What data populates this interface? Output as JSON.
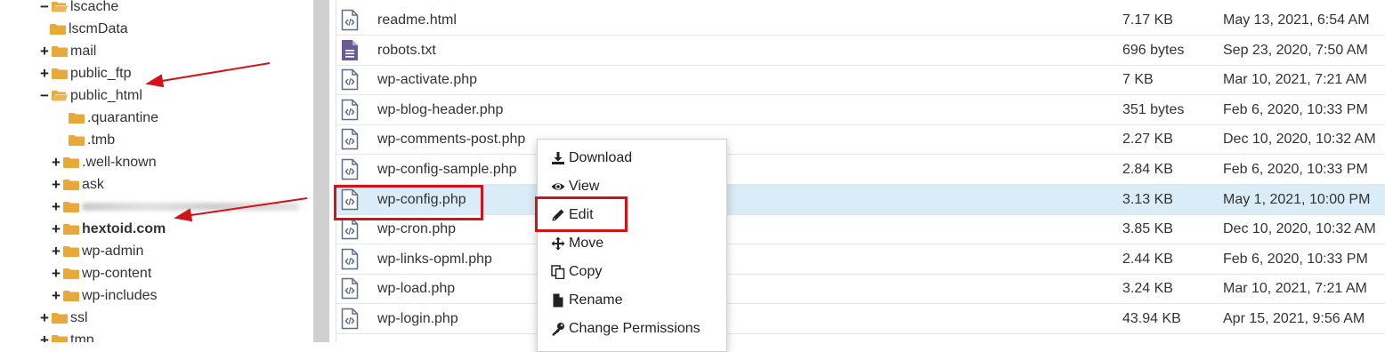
{
  "tree": [
    {
      "label": "lscache",
      "toggle": "−",
      "indent": 0,
      "open": true,
      "bold": false
    },
    {
      "label": "lscmData",
      "toggle": "",
      "indent": 1,
      "open": false,
      "bold": false
    },
    {
      "label": "mail",
      "toggle": "+",
      "indent": 0,
      "open": false,
      "bold": false
    },
    {
      "label": "public_ftp",
      "toggle": "+",
      "indent": 0,
      "open": false,
      "bold": false
    },
    {
      "label": "public_html",
      "toggle": "−",
      "indent": 0,
      "open": true,
      "bold": false
    },
    {
      "label": ".quarantine",
      "toggle": "",
      "indent": 2,
      "open": false,
      "bold": false
    },
    {
      "label": ".tmb",
      "toggle": "",
      "indent": 2,
      "open": false,
      "bold": false
    },
    {
      "label": ".well-known",
      "toggle": "+",
      "indent": 1,
      "open": false,
      "bold": false
    },
    {
      "label": "ask",
      "toggle": "+",
      "indent": 1,
      "open": false,
      "bold": false
    },
    {
      "label": "",
      "toggle": "+",
      "indent": 1,
      "open": false,
      "bold": false,
      "blurred": true
    },
    {
      "label": "hextoid.com",
      "toggle": "+",
      "indent": 1,
      "open": false,
      "bold": true
    },
    {
      "label": "wp-admin",
      "toggle": "+",
      "indent": 1,
      "open": false,
      "bold": false
    },
    {
      "label": "wp-content",
      "toggle": "+",
      "indent": 1,
      "open": false,
      "bold": false
    },
    {
      "label": "wp-includes",
      "toggle": "+",
      "indent": 1,
      "open": false,
      "bold": false
    },
    {
      "label": "ssl",
      "toggle": "+",
      "indent": 0,
      "open": false,
      "bold": false
    },
    {
      "label": "tmp",
      "toggle": "+",
      "indent": 0,
      "open": false,
      "bold": false
    }
  ],
  "files": [
    {
      "name": "readme.html",
      "size": "7.17 KB",
      "date": "May 13, 2021, 6:54 AM",
      "kind": "code",
      "selected": false
    },
    {
      "name": "robots.txt",
      "size": "696 bytes",
      "date": "Sep 23, 2020, 7:50 AM",
      "kind": "text",
      "selected": false
    },
    {
      "name": "wp-activate.php",
      "size": "7 KB",
      "date": "Mar 10, 2021, 7:21 AM",
      "kind": "code",
      "selected": false
    },
    {
      "name": "wp-blog-header.php",
      "size": "351 bytes",
      "date": "Feb 6, 2020, 10:33 PM",
      "kind": "code",
      "selected": false
    },
    {
      "name": "wp-comments-post.php",
      "size": "2.27 KB",
      "date": "Dec 10, 2020, 10:32 AM",
      "kind": "code",
      "selected": false
    },
    {
      "name": "wp-config-sample.php",
      "size": "2.84 KB",
      "date": "Feb 6, 2020, 10:33 PM",
      "kind": "code",
      "selected": false
    },
    {
      "name": "wp-config.php",
      "size": "3.13 KB",
      "date": "May 1, 2021, 10:00 PM",
      "kind": "code",
      "selected": true
    },
    {
      "name": "wp-cron.php",
      "size": "3.85 KB",
      "date": "Dec 10, 2020, 10:32 AM",
      "kind": "code",
      "selected": false
    },
    {
      "name": "wp-links-opml.php",
      "size": "2.44 KB",
      "date": "Feb 6, 2020, 10:33 PM",
      "kind": "code",
      "selected": false
    },
    {
      "name": "wp-load.php",
      "size": "3.24 KB",
      "date": "Mar 10, 2021, 7:21 AM",
      "kind": "code",
      "selected": false
    },
    {
      "name": "wp-login.php",
      "size": "43.94 KB",
      "date": "Apr 15, 2021, 9:56 AM",
      "kind": "code",
      "selected": false
    }
  ],
  "context_menu": [
    {
      "label": "Download",
      "icon": "download-icon"
    },
    {
      "label": "View",
      "icon": "eye-icon"
    },
    {
      "label": "Edit",
      "icon": "pencil-icon"
    },
    {
      "label": "Move",
      "icon": "move-arrows-icon"
    },
    {
      "label": "Copy",
      "icon": "copy-icon"
    },
    {
      "label": "Rename",
      "icon": "file-icon"
    },
    {
      "label": "Change Permissions",
      "icon": "key-icon"
    }
  ],
  "colors": {
    "folder": "#e8a93a",
    "highlight": "#d0141a",
    "selected_row": "#d9ecf7",
    "code_icon": "#5f6f86",
    "text_icon": "#6b5b95"
  }
}
